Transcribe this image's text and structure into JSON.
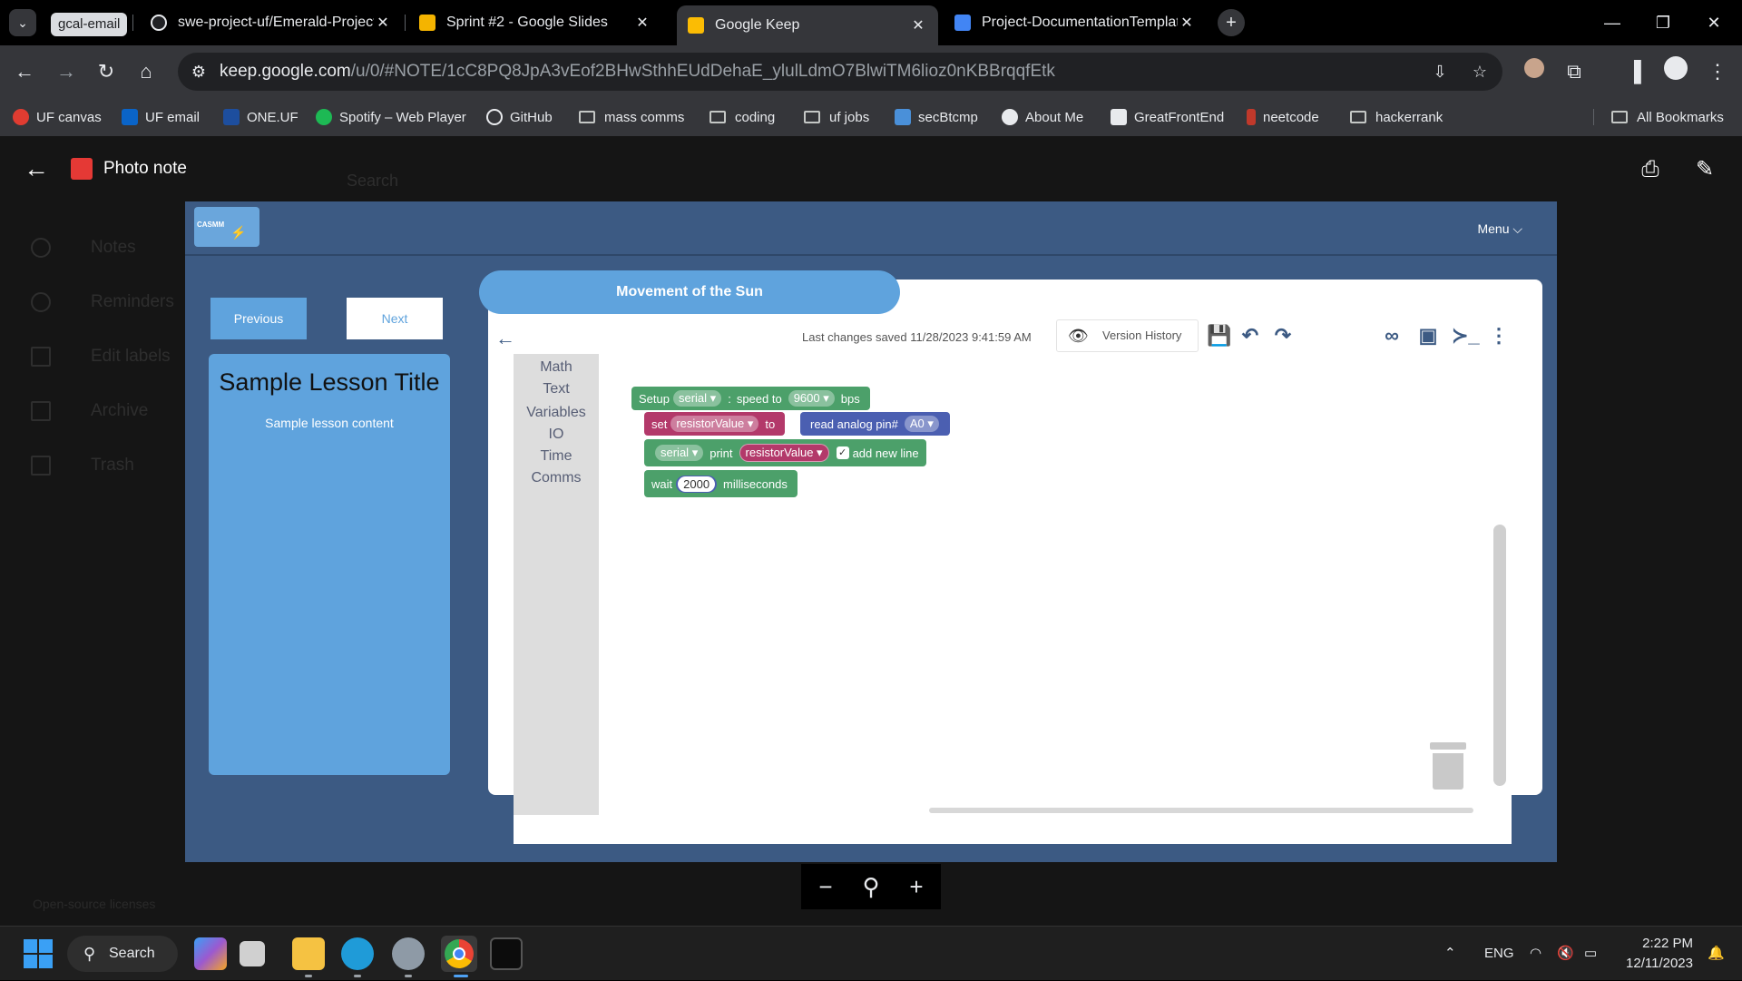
{
  "browser": {
    "tab_group": "gcal-email",
    "tabs": [
      {
        "title": "swe-project-uf/Emerald-Project",
        "icon": "github-icon"
      },
      {
        "title": "Sprint #2 - Google Slides",
        "icon": "slides-icon"
      },
      {
        "title": "Google Keep",
        "icon": "keep-icon",
        "active": true
      },
      {
        "title": "Project-DocumentationTemplat",
        "icon": "docs-icon"
      }
    ],
    "url_host": "keep.google.com",
    "url_path": "/u/0/#NOTE/1cC8PQ8JpA3vEof2BHwSthhEUdDehaE_ylulLdmO7BlwiTM6lioz0nKBBrqqfEtk",
    "bookmarks": [
      "UF canvas",
      "UF email",
      "ONE.UF",
      "Spotify – Web Player",
      "GitHub",
      "mass comms",
      "coding",
      "uf jobs",
      "secBtcmp",
      "About Me",
      "GreatFrontEnd",
      "neetcode",
      "hackerrank"
    ],
    "all_bookmarks": "All Bookmarks"
  },
  "keep": {
    "search_placeholder": "Search",
    "nav": [
      "Notes",
      "Reminders",
      "Edit labels",
      "Archive",
      "Trash"
    ],
    "license": "Open-source licenses"
  },
  "viewer": {
    "title": "Photo note"
  },
  "app": {
    "logo_text": "CASMM",
    "menu": "Menu ⌵",
    "previous": "Previous",
    "next": "Next",
    "lesson_title": "Sample Lesson Title",
    "lesson_content": "Sample lesson content",
    "activity_title": "Movement of the Sun",
    "last_saved": "Last changes saved 11/28/2023 9:41:59 AM",
    "version_history": "Version History",
    "toolbox": [
      "Math",
      "Text",
      "Variables",
      "IO",
      "Time",
      "Comms"
    ],
    "blocks": {
      "setup": {
        "kw": "Setup",
        "port": "serial",
        "colon": ":",
        "speed": "speed to",
        "baud": "9600",
        "unit": "bps"
      },
      "set": {
        "kw": "set",
        "var": "resistorValue",
        "to": "to",
        "read": "read analog pin#",
        "pin": "A0"
      },
      "print": {
        "port": "serial",
        "kw": "print",
        "var": "resistorValue",
        "newline": "add new line"
      },
      "wait": {
        "kw": "wait",
        "ms": "2000",
        "unit": "milliseconds"
      }
    }
  },
  "taskbar": {
    "search": "Search",
    "lang": "ENG",
    "time": "2:22 PM",
    "date": "12/11/2023"
  },
  "colors": {
    "app_bg": "#3c5a83",
    "accent_blue": "#5fa3dd",
    "block_comms": "#4ca06a",
    "block_var": "#b3396a",
    "block_io": "#4b5fb1"
  }
}
